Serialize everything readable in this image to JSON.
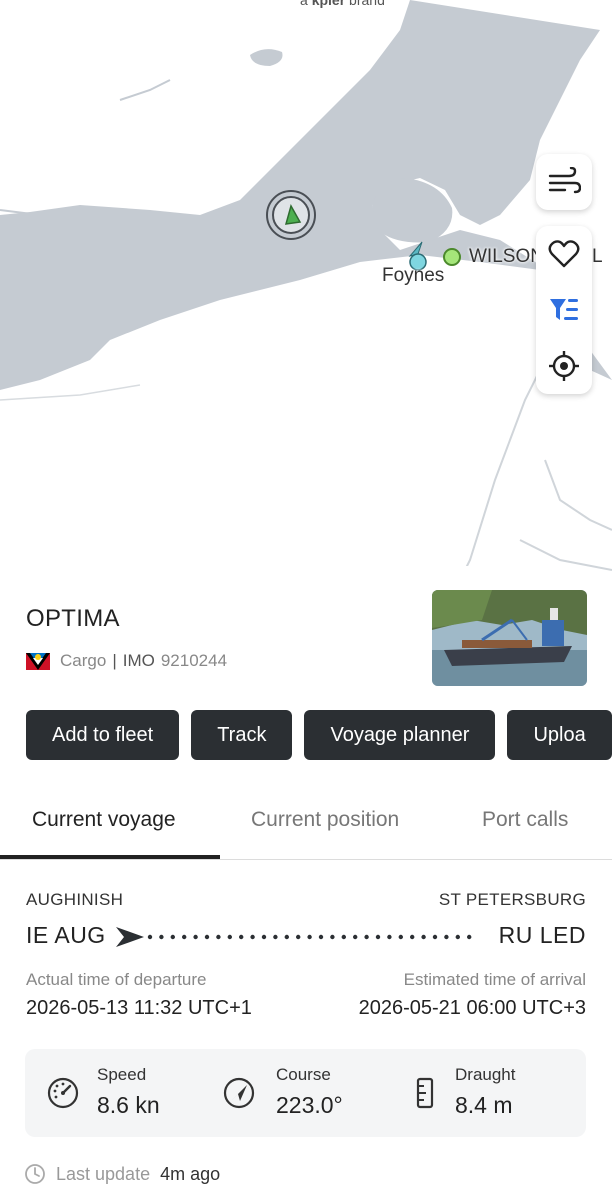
{
  "map": {
    "brand_prefix": "a",
    "brand_name": "kpler",
    "brand_suffix": "brand",
    "port_label": "Foynes",
    "terminal_label": "WILSON",
    "terminal_label_tail": "L",
    "colors": {
      "land": "#ffffff",
      "water": "#c5cbd2",
      "vessel": "#4caf50",
      "port_dot": "#a5e67a",
      "port_cluster": "#7fd6e0"
    }
  },
  "map_controls": {
    "wind_icon": "wind-icon",
    "favorite_icon": "heart-icon",
    "filter_icon": "filter-icon",
    "locate_icon": "crosshair-icon"
  },
  "vessel": {
    "name": "OPTIMA",
    "type": "Cargo",
    "separator": "|",
    "imo_label": "IMO",
    "imo": "9210244",
    "flag": "Antigua and Barbuda"
  },
  "actions": [
    "Add to fleet",
    "Track",
    "Voyage planner",
    "Uploa"
  ],
  "tabs": [
    "Current voyage",
    "Current position",
    "Port calls"
  ],
  "active_tab": 0,
  "voyage": {
    "origin_name": "AUGHINISH",
    "origin_code": "IE AUG",
    "destination_name": "ST PETERSBURG",
    "destination_code": "RU LED",
    "departure_label": "Actual time of departure",
    "departure_time": "2026-05-13 11:32 UTC+1",
    "arrival_label": "Estimated time of arrival",
    "arrival_time": "2026-05-21 06:00 UTC+3",
    "progress": 0.0
  },
  "stats": {
    "speed_label": "Speed",
    "speed_value": "8.6 kn",
    "course_label": "Course",
    "course_value": "223.0°",
    "draught_label": "Draught",
    "draught_value": "8.4 m"
  },
  "last_update": {
    "label": "Last update",
    "value": "4m ago"
  }
}
